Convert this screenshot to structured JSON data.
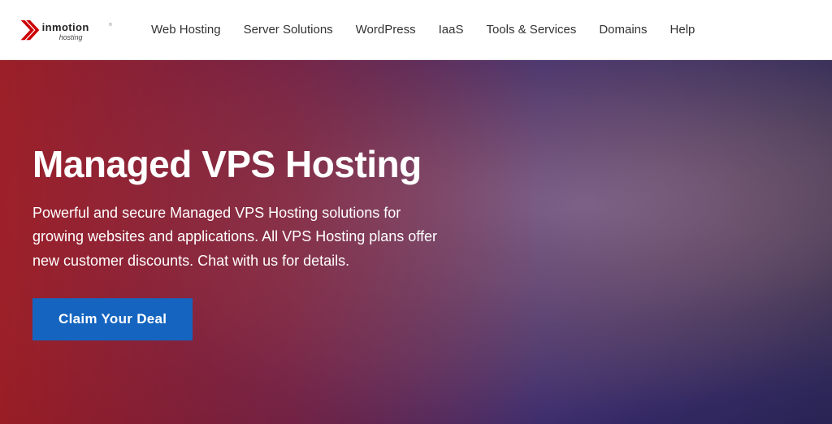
{
  "navbar": {
    "logo_alt": "InMotion Hosting",
    "nav_items": [
      {
        "label": "Web Hosting",
        "id": "web-hosting"
      },
      {
        "label": "Server Solutions",
        "id": "server-solutions"
      },
      {
        "label": "WordPress",
        "id": "wordpress"
      },
      {
        "label": "IaaS",
        "id": "iaas"
      },
      {
        "label": "Tools & Services",
        "id": "tools-services"
      },
      {
        "label": "Domains",
        "id": "domains"
      },
      {
        "label": "Help",
        "id": "help"
      }
    ]
  },
  "hero": {
    "title": "Managed VPS Hosting",
    "description": "Powerful and secure Managed VPS Hosting solutions for growing websites and applications. All VPS Hosting plans offer new customer discounts. Chat with us for details.",
    "cta_label": "Claim Your Deal"
  }
}
